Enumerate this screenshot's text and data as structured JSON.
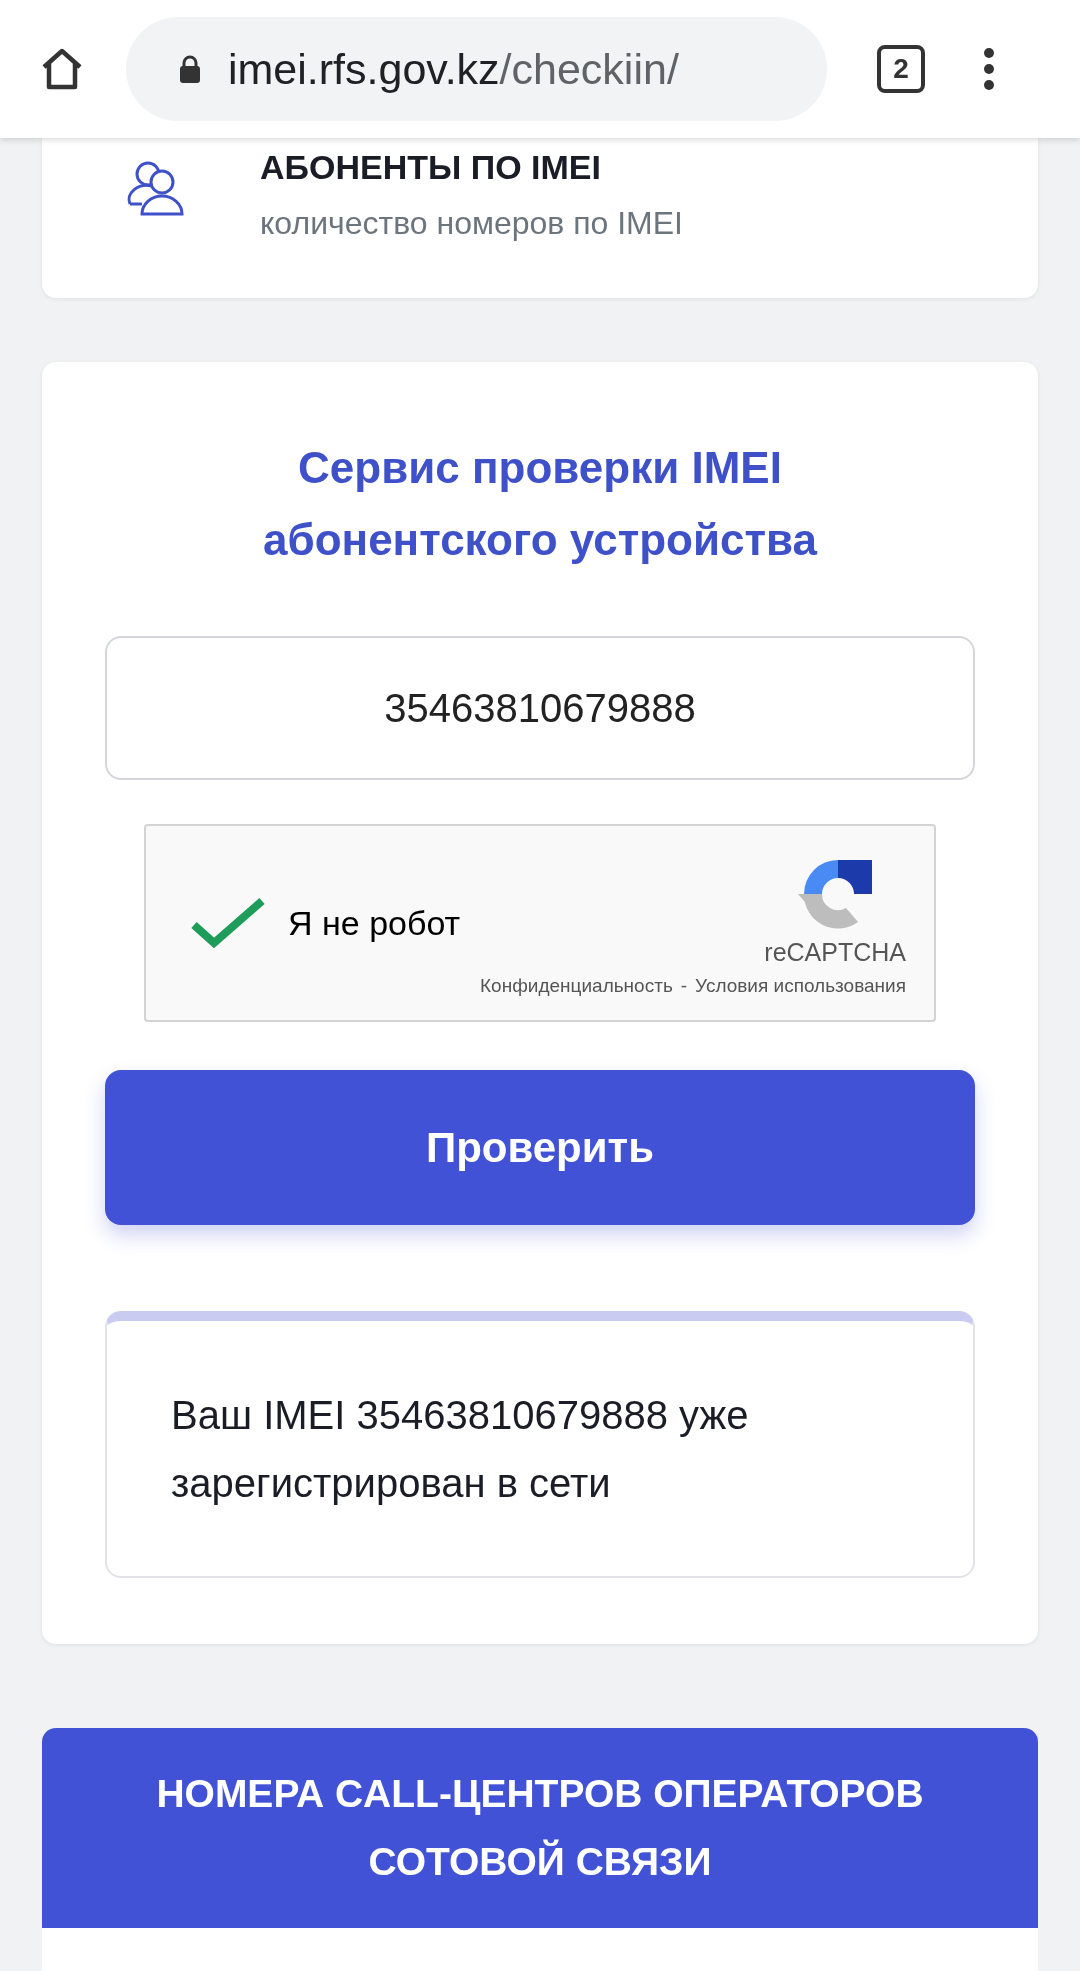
{
  "browser": {
    "url_host": "imei.rfs.gov.kz",
    "url_path": "/checkiin/",
    "tab_count": "2"
  },
  "subscribers_card": {
    "title": "АБОНЕНТЫ ПО IMEI",
    "subtitle": "количество номеров по IMEI"
  },
  "check_form": {
    "title": "Сервис проверки IMEI абонентского устройства",
    "imei_value": "35463810679888",
    "captcha": {
      "label": "Я не робот",
      "checked": true,
      "brand": "reCAPTCHA",
      "privacy_link": "Конфиденциальность",
      "separator": "-",
      "terms_link": "Условия использования"
    },
    "submit_button": "Проверить",
    "result_message": "Ваш IMEI 35463810679888 уже зарегистрирован в сети"
  },
  "call_centers": {
    "title": "НОМЕРА CALL-ЦЕНТРОВ ОПЕРАТОРОВ СОТОВОЙ СВЯЗИ"
  }
}
